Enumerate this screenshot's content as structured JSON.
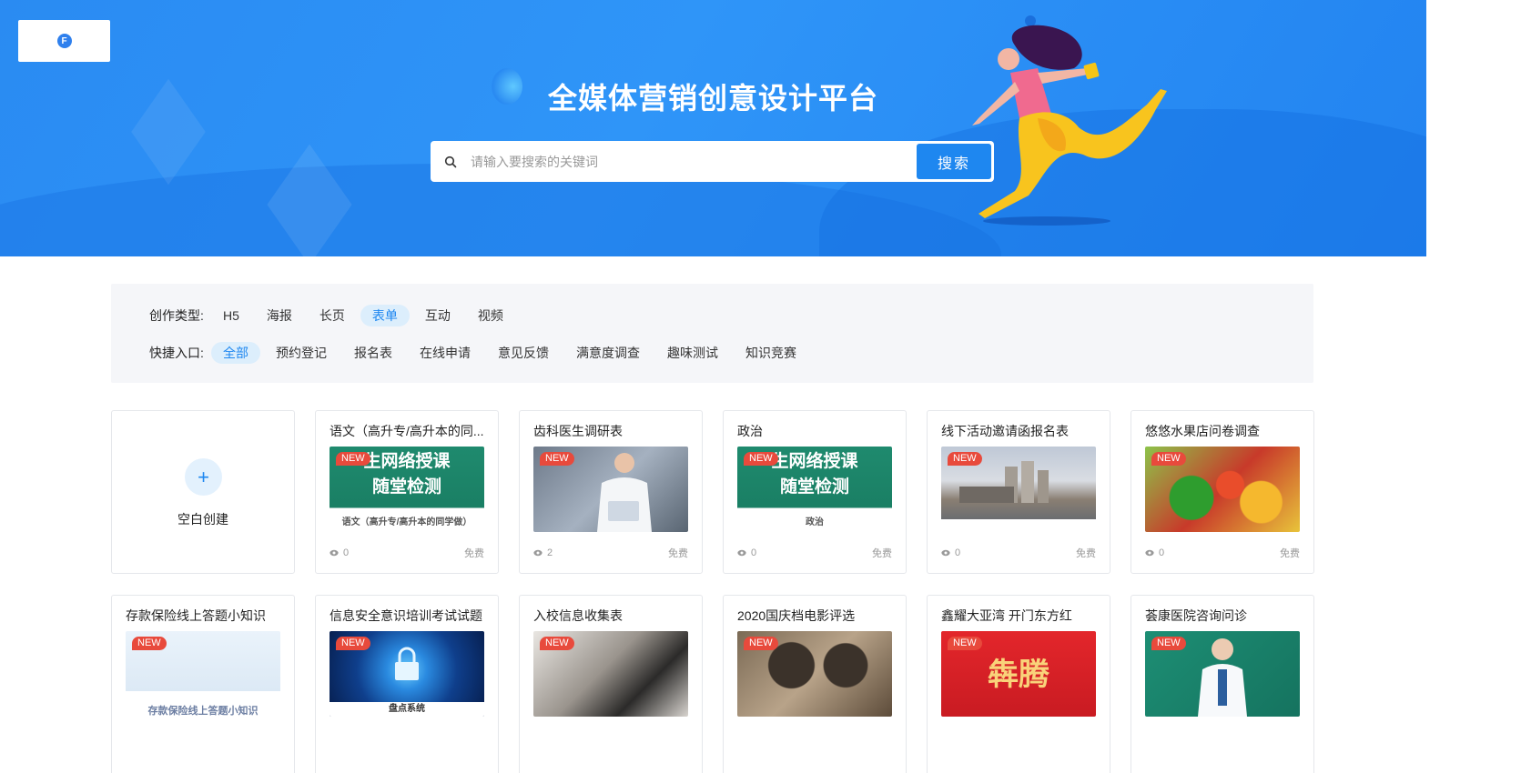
{
  "header": {
    "title": "全媒体营销创意设计平台",
    "logo_letter": "F",
    "search": {
      "placeholder": "请输入要搜索的关键词",
      "button": "搜索"
    }
  },
  "filters": {
    "type_label": "创作类型:",
    "types": [
      "H5",
      "海报",
      "长页",
      "表单",
      "互动",
      "视频"
    ],
    "active_type": "表单",
    "quick_label": "快捷入口:",
    "quick": [
      "全部",
      "预约登记",
      "报名表",
      "在线申请",
      "意见反馈",
      "满意度调查",
      "趣味测试",
      "知识竞赛"
    ],
    "active_quick": "全部"
  },
  "blank_card": {
    "label": "空白创建",
    "icon": "+"
  },
  "badge_text": "NEW",
  "cards": [
    {
      "title": "语文（高升专/高升本的同...",
      "views": "0",
      "price": "免费",
      "thumb_text": "生网络授课\n随堂检测",
      "thumb_sub": "语文（高升专/高升本的同学做）"
    },
    {
      "title": "齿科医生调研表",
      "views": "2",
      "price": "免费"
    },
    {
      "title": "政治",
      "views": "0",
      "price": "免费",
      "thumb_text": "生网络授课\n随堂检测",
      "thumb_sub": "政治"
    },
    {
      "title": "线下活动邀请函报名表",
      "views": "0",
      "price": "免费"
    },
    {
      "title": "悠悠水果店问卷调查",
      "views": "0",
      "price": "免费"
    },
    {
      "title": "存款保险线上答题小知识",
      "thumb_sub": "存款保险线上答题小知识"
    },
    {
      "title": "信息安全意识培训考试试题",
      "thumb_sub": "盘点系统"
    },
    {
      "title": "入校信息收集表"
    },
    {
      "title": "2020国庆档电影评选"
    },
    {
      "title": "鑫耀大亚湾  开门东方红",
      "thumb_text": "犇腾"
    },
    {
      "title": "荟康医院咨询问诊"
    }
  ]
}
